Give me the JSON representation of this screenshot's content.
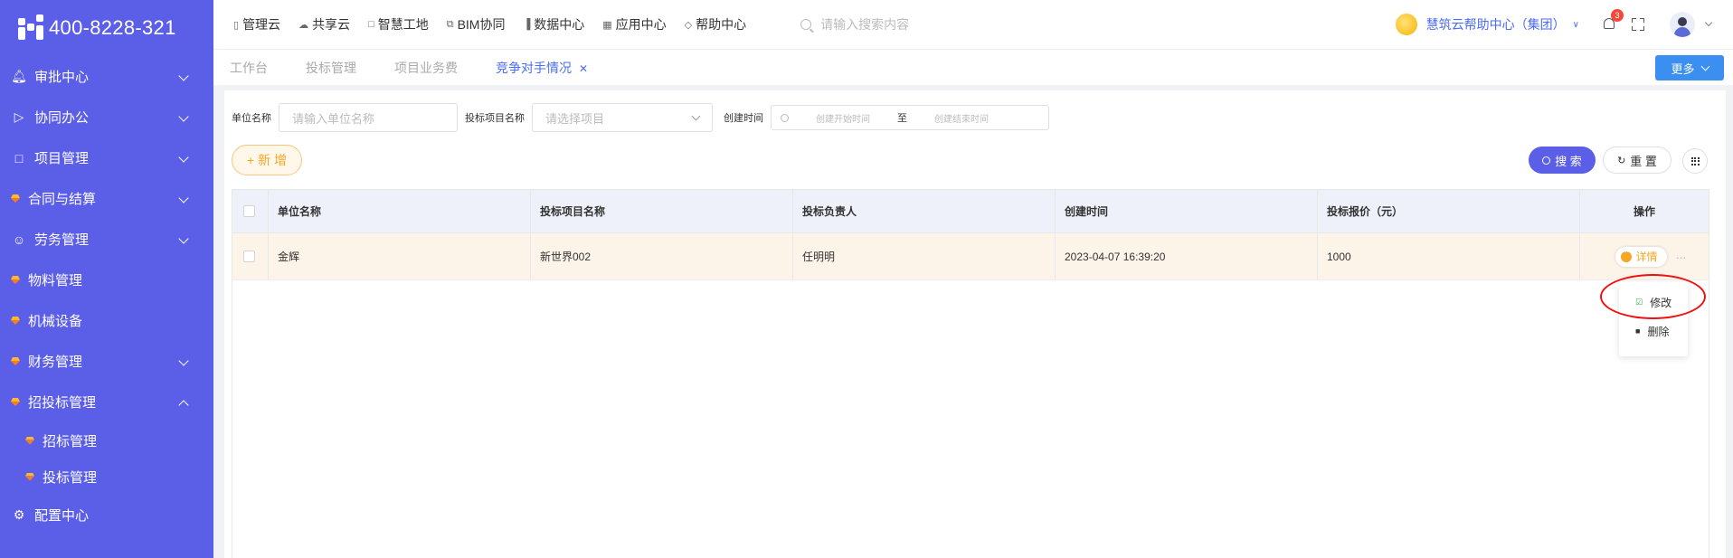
{
  "brand": {
    "phone": "400-8228-321"
  },
  "sidebar": {
    "items": [
      {
        "label": "审批中心",
        "icon": "bell-icon",
        "expandable": true
      },
      {
        "label": "协同办公",
        "icon": "send-icon",
        "expandable": true
      },
      {
        "label": "项目管理",
        "icon": "book-icon",
        "expandable": true
      },
      {
        "label": "合同与结算",
        "icon": "gem-icon",
        "expandable": true
      },
      {
        "label": "劳务管理",
        "icon": "user-icon",
        "expandable": true
      },
      {
        "label": "物料管理",
        "icon": "gem-icon",
        "expandable": false
      },
      {
        "label": "机械设备",
        "icon": "gem-icon",
        "expandable": false
      },
      {
        "label": "财务管理",
        "icon": "gem-icon",
        "expandable": true
      },
      {
        "label": "招投标管理",
        "icon": "gem-icon",
        "expandable": true,
        "expanded": true
      }
    ],
    "subitems": [
      {
        "label": "招标管理"
      },
      {
        "label": "投标管理"
      }
    ],
    "config": {
      "label": "配置中心",
      "icon": "gear-icon"
    }
  },
  "topnav": {
    "items": [
      {
        "label": "管理云",
        "icon": "doc-icon"
      },
      {
        "label": "共享云",
        "icon": "cloud-icon"
      },
      {
        "label": "智慧工地",
        "icon": "book-icon"
      },
      {
        "label": "BIM协同",
        "icon": "layers-icon"
      },
      {
        "label": "数据中心",
        "icon": "bar-chart-icon"
      },
      {
        "label": "应用中心",
        "icon": "grid-icon"
      },
      {
        "label": "帮助中心",
        "icon": "diamond-icon"
      }
    ],
    "search_placeholder": "请输入搜索内容",
    "org_name": "慧筑云帮助中心（集团）",
    "notification_count": "3"
  },
  "tabs": [
    {
      "label": "工作台",
      "active": false
    },
    {
      "label": "投标管理",
      "active": false
    },
    {
      "label": "项目业务费",
      "active": false
    },
    {
      "label": "竞争对手情况",
      "active": true,
      "closable": true
    }
  ],
  "more_label": "更多",
  "filters": {
    "unit_label": "单位名称",
    "unit_placeholder": "请输入单位名称",
    "project_label": "投标项目名称",
    "project_placeholder": "请选择项目",
    "time_label": "创建时间",
    "start_placeholder": "创建开始时间",
    "range_sep": "至",
    "end_placeholder": "创建结束时间"
  },
  "buttons": {
    "add": "+ 新 增",
    "search": "搜 索",
    "reset": "重 置"
  },
  "table": {
    "headers": [
      "单位名称",
      "投标项目名称",
      "投标负责人",
      "创建时间",
      "投标报价（元）",
      "操作"
    ],
    "rows": [
      {
        "unit": "金辉",
        "project": "新世界002",
        "person": "任明明",
        "time": "2023-04-07 16:39:20",
        "price": "1000"
      }
    ],
    "detail_label": "详情"
  },
  "popup": {
    "edit_label": "修改",
    "delete_label": "删除"
  },
  "colors": {
    "sidebar_bg": "#5b5ee6",
    "accent": "#4a6cf7",
    "add_orange": "#f5a623",
    "highlight_row": "#fdf4e9",
    "annotation_red": "#e11111"
  }
}
